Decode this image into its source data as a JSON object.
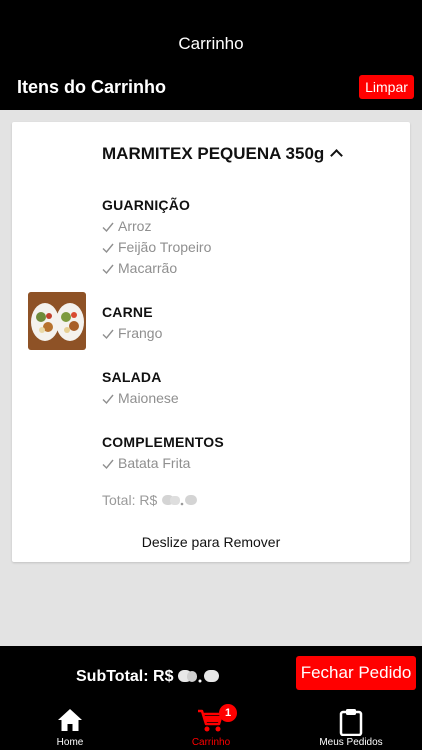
{
  "header": {
    "title": "Carrinho",
    "section_title": "Itens do Carrinho",
    "clear_label": "Limpar"
  },
  "cart_item": {
    "name": "MARMITEX PEQUENA 350g",
    "groups": [
      {
        "title": "GUARNIÇÃO",
        "options": [
          "Arroz",
          "Feijão Tropeiro",
          "Macarrão"
        ]
      },
      {
        "title": "CARNE",
        "options": [
          "Frango"
        ]
      },
      {
        "title": "SALADA",
        "options": [
          "Maionese"
        ]
      },
      {
        "title": "COMPLEMENTOS",
        "options": [
          "Batata Frita"
        ]
      }
    ],
    "total_label": "Total: R$",
    "swipe_hint": "Deslize para Remover"
  },
  "footer": {
    "subtotal_label": "SubTotal: R$",
    "checkout_label": "Fechar Pedido"
  },
  "tabs": [
    {
      "label": "Home",
      "icon": "home-icon"
    },
    {
      "label": "Carrinho",
      "icon": "cart-icon",
      "badge": "1",
      "active": true
    },
    {
      "label": "Meus Pedidos",
      "icon": "clipboard-icon"
    }
  ],
  "colors": {
    "accent": "#ff0000",
    "bar": "#000000",
    "background": "#e3e3e3"
  }
}
